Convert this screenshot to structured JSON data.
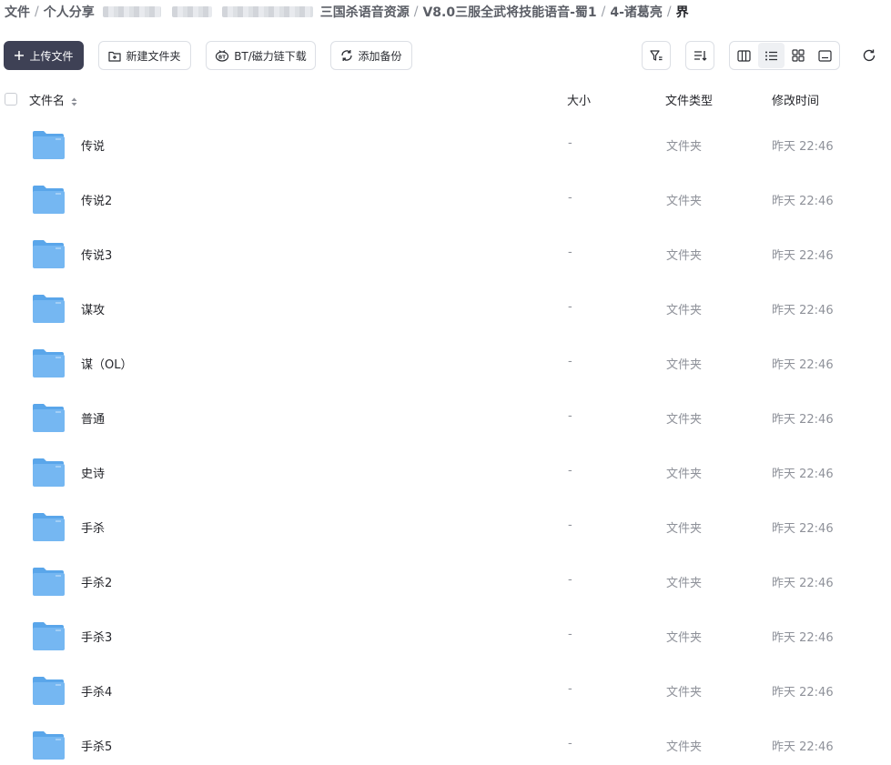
{
  "breadcrumb": {
    "items": [
      {
        "label": "文件"
      },
      {
        "label": "个人分享"
      },
      {
        "label": "三国杀语音资源"
      },
      {
        "label": "V8.0三服全武将技能语音-蜀1"
      },
      {
        "label": "4-诸葛亮"
      },
      {
        "label": "界"
      }
    ],
    "separator": "/"
  },
  "toolbar": {
    "upload_label": "上传文件",
    "new_folder_label": "新建文件夹",
    "bt_download_label": "BT/磁力链下载",
    "add_backup_label": "添加备份"
  },
  "table": {
    "col_name": "文件名",
    "col_size": "大小",
    "col_type": "文件类型",
    "col_time": "修改时间"
  },
  "rows": [
    {
      "name": "传说",
      "size": "-",
      "type": "文件夹",
      "time": "昨天 22:46"
    },
    {
      "name": "传说2",
      "size": "-",
      "type": "文件夹",
      "time": "昨天 22:46"
    },
    {
      "name": "传说3",
      "size": "-",
      "type": "文件夹",
      "time": "昨天 22:46"
    },
    {
      "name": "谋攻",
      "size": "-",
      "type": "文件夹",
      "time": "昨天 22:46"
    },
    {
      "name": "谋（OL）",
      "size": "-",
      "type": "文件夹",
      "time": "昨天 22:46"
    },
    {
      "name": "普通",
      "size": "-",
      "type": "文件夹",
      "time": "昨天 22:46"
    },
    {
      "name": "史诗",
      "size": "-",
      "type": "文件夹",
      "time": "昨天 22:46"
    },
    {
      "name": "手杀",
      "size": "-",
      "type": "文件夹",
      "time": "昨天 22:46"
    },
    {
      "name": "手杀2",
      "size": "-",
      "type": "文件夹",
      "time": "昨天 22:46"
    },
    {
      "name": "手杀3",
      "size": "-",
      "type": "文件夹",
      "time": "昨天 22:46"
    },
    {
      "name": "手杀4",
      "size": "-",
      "type": "文件夹",
      "time": "昨天 22:46"
    },
    {
      "name": "手杀5",
      "size": "-",
      "type": "文件夹",
      "time": "昨天 22:46"
    }
  ],
  "icons": {
    "upload": "plus-icon",
    "new_folder": "folder-plus-icon",
    "bt": "bt-icon",
    "backup": "sync-icon",
    "filter": "filter-icon",
    "sort": "sort-icon",
    "view_columns": "columns-view-icon",
    "view_list": "list-view-icon",
    "view_grid": "grid-view-icon",
    "view_preview": "preview-view-icon",
    "refresh": "refresh-icon",
    "folder": "folder-icon"
  },
  "colors": {
    "primary_button": "#3e4155",
    "folder": "#6cb2ef",
    "muted_text": "#8e9199"
  }
}
